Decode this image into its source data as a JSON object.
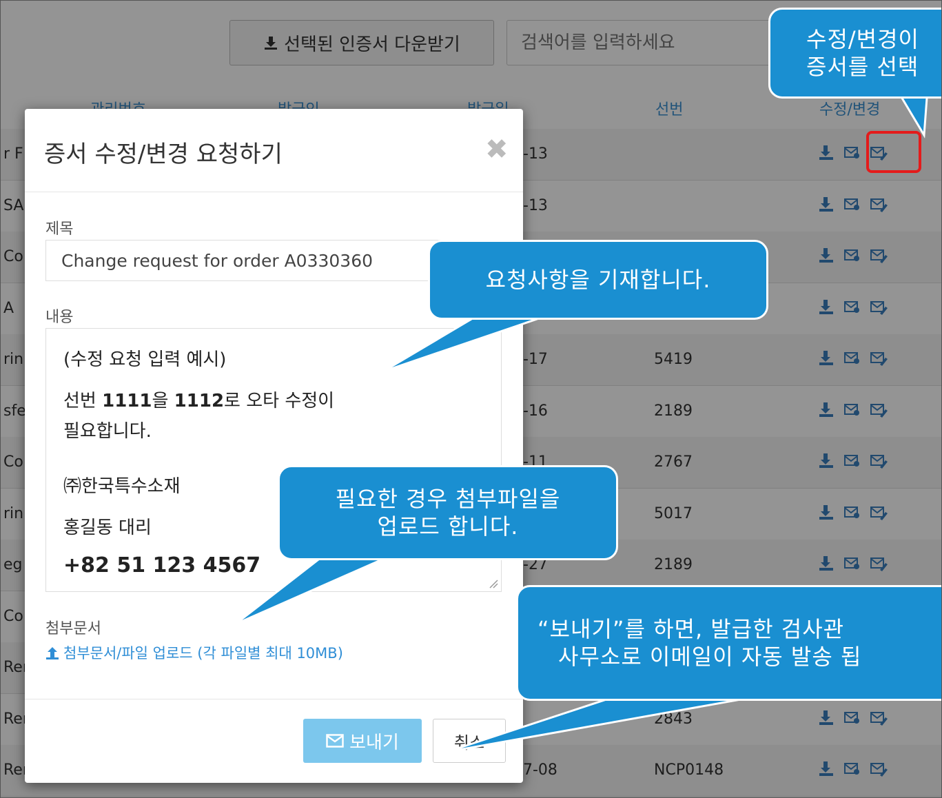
{
  "toolbar": {
    "download_selected_label": "선택된 인증서 다운받기",
    "search_placeholder": "검색어를 입력하세요"
  },
  "table": {
    "headers": {
      "mgmt_no": "관리번호",
      "issuer": "발급인",
      "issue_date": "발급일",
      "hull_no": "선번",
      "edit_change": "수정/변경"
    },
    "rows": [
      {
        "left": "r F",
        "date": "-13",
        "hull": ""
      },
      {
        "left": "SA",
        "date": "-13",
        "hull": ""
      },
      {
        "left": "Co",
        "date": "",
        "hull": ""
      },
      {
        "left": "A",
        "date": "",
        "hull": ""
      },
      {
        "left": "rin",
        "date": "-17",
        "hull": "5419"
      },
      {
        "left": "sfe",
        "date": "-16",
        "hull": "2189"
      },
      {
        "left": "Co",
        "date": "-11",
        "hull": "2767"
      },
      {
        "left": "rin",
        "date": "",
        "hull": "5017"
      },
      {
        "left": "eg",
        "date": "-27",
        "hull": "2189"
      },
      {
        "left": "Co",
        "date": "",
        "hull": ""
      },
      {
        "left": "Rer",
        "date": "",
        "hull": ""
      },
      {
        "left": "Rer",
        "date": "",
        "hull": "2843"
      },
      {
        "left": "Rer",
        "date": "7-08",
        "hull": "NCP0148"
      }
    ]
  },
  "dialog": {
    "title": "증서 수정/변경 요청하기",
    "close_symbol": "✖",
    "subject_label": "제목",
    "subject_value": "Change request for order A0330360",
    "content_label": "내용",
    "content": {
      "example_line": "(수정 요청 입력 예시)",
      "line1_a": "선번 ",
      "line1_b": "1111",
      "line1_c": "을 ",
      "line1_d": "1112",
      "line1_e": "로 오타 수정이",
      "line2": "필요합니다.",
      "company": "㈜한국특수소재",
      "person": "홍길동 대리",
      "phone": "+82 51 123 4567"
    },
    "attachment_label": "첨부문서",
    "upload_link": "첨부문서/파일 업로드 (각 파일별 최대 10MB)",
    "send_label": "보내기",
    "cancel_label": "취소"
  },
  "callouts": {
    "top_right_line1": "수정/변경이",
    "top_right_line2": "증서를 선택",
    "request": "요청사항을 기재합니다.",
    "attach_line1": "필요한 경우 첨부파일을",
    "attach_line2": "업로드 합니다.",
    "send_line1": "“보내기”를 하면, 발급한 검사관",
    "send_line2": "사무소로 이메일이 자동 발송 됩"
  },
  "colors": {
    "callout_bg": "#1a8fd1",
    "link": "#2f8ed6",
    "highlight": "#e41b1b",
    "send_button": "#7cc7ed"
  }
}
